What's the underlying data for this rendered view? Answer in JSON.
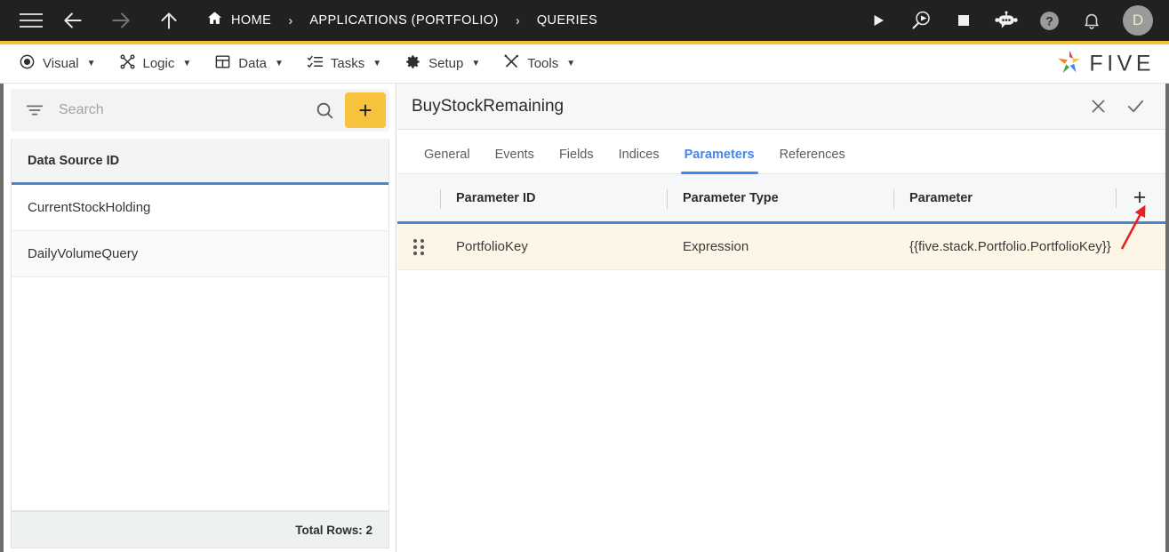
{
  "topbar": {
    "menu_icon": "hamburger-icon",
    "back_icon": "arrow-left-icon",
    "forward_icon": "arrow-right-icon",
    "up_icon": "arrow-up-icon",
    "breadcrumbs": [
      {
        "label": "HOME",
        "icon": "home-icon"
      },
      {
        "label": "APPLICATIONS (PORTFOLIO)",
        "icon": ""
      },
      {
        "label": "QUERIES",
        "icon": ""
      }
    ],
    "separator": "›",
    "actions": [
      {
        "name": "run-icon",
        "title": "Run"
      },
      {
        "name": "debug-icon",
        "title": "Debug"
      },
      {
        "name": "stop-icon",
        "title": "Stop"
      },
      {
        "name": "bot-icon",
        "title": "Assistant"
      },
      {
        "name": "help-icon",
        "title": "Help"
      },
      {
        "name": "bell-icon",
        "title": "Notifications"
      }
    ],
    "avatar_letter": "D"
  },
  "menubar": {
    "items": [
      {
        "label": "Visual",
        "icon": "eye-icon",
        "caret": "▼"
      },
      {
        "label": "Logic",
        "icon": "logic-icon",
        "caret": "▼"
      },
      {
        "label": "Data",
        "icon": "table-icon",
        "caret": "▼"
      },
      {
        "label": "Tasks",
        "icon": "tasks-icon",
        "caret": "▼"
      },
      {
        "label": "Setup",
        "icon": "gear-icon",
        "caret": "▼"
      },
      {
        "label": "Tools",
        "icon": "tools-icon",
        "caret": "▼"
      }
    ],
    "brand": {
      "word": "FIVE",
      "logo": "five-star-logo"
    }
  },
  "sidebar": {
    "search": {
      "placeholder": "Search",
      "value": "",
      "filter_icon": "filter-icon",
      "search_icon": "search-icon"
    },
    "add_button_label": "+",
    "table": {
      "header": "Data Source ID",
      "rows": [
        {
          "name": "CurrentStockHolding"
        },
        {
          "name": "DailyVolumeQuery"
        }
      ]
    },
    "total_rows_label": "Total Rows: 2"
  },
  "main": {
    "title": "BuyStockRemaining",
    "close_icon": "close-icon",
    "confirm_icon": "check-icon",
    "tabs": [
      {
        "label": "General",
        "active": false
      },
      {
        "label": "Events",
        "active": false
      },
      {
        "label": "Fields",
        "active": false
      },
      {
        "label": "Indices",
        "active": false
      },
      {
        "label": "Parameters",
        "active": true
      },
      {
        "label": "References",
        "active": false
      }
    ],
    "grid": {
      "columns": [
        "Parameter ID",
        "Parameter Type",
        "Parameter"
      ],
      "add_row_label": "+",
      "rows": [
        {
          "parameter_id": "PortfolioKey",
          "parameter_type": "Expression",
          "parameter": "{{five.stack.Portfolio.PortfolioKey}}"
        }
      ]
    }
  },
  "colors": {
    "topbar_bg": "#212121",
    "accent_yellow": "#f6c232",
    "tab_active_blue": "#4285f4",
    "grid_header_rule": "#4a86d0",
    "row_highlight": "#fdf6e6",
    "annotation_red": "#e52421"
  }
}
